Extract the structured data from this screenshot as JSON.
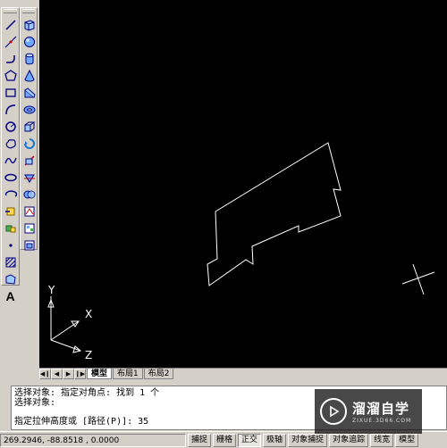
{
  "draw_toolbar": {
    "icons": [
      "line-icon",
      "construction-line-icon",
      "polyline-icon",
      "polygon-icon",
      "rectangle-icon",
      "arc-icon",
      "circle-icon",
      "revision-cloud-icon",
      "spline-icon",
      "ellipse-icon",
      "ellipse-arc-icon",
      "insert-block-icon",
      "make-block-icon",
      "point-icon",
      "hatch-icon",
      "region-icon",
      "text-icon"
    ],
    "text_tool": "A"
  },
  "modeling_toolbar": {
    "icons": [
      "box-icon",
      "sphere-icon",
      "cylinder-icon",
      "cone-icon",
      "wedge-icon",
      "torus-icon",
      "extrude-icon",
      "revolve-icon",
      "slice-icon",
      "section-icon",
      "interference-icon",
      "setup-drawing-icon",
      "setup-view-icon",
      "setup-profile-icon"
    ]
  },
  "ucs": {
    "x_label": "X",
    "y_label": "Y",
    "z_label": "Z"
  },
  "layout_tabs": [
    {
      "label": "模型",
      "active": true
    },
    {
      "label": "布局1",
      "active": false
    },
    {
      "label": "布局2",
      "active": false
    }
  ],
  "command_history": [
    "选择对象: 指定对角点: 找到 1 个",
    "选择对象:"
  ],
  "command_prompt": "指定拉伸高度或 [路径(P)]: 35",
  "status": {
    "coordinates": "269.2946, -88.8518 , 0.0000",
    "buttons": [
      {
        "label": "捕捉",
        "on": false
      },
      {
        "label": "栅格",
        "on": false
      },
      {
        "label": "正交",
        "on": true
      },
      {
        "label": "极轴",
        "on": false
      },
      {
        "label": "对象捕捉",
        "on": false
      },
      {
        "label": "对象追踪",
        "on": false
      },
      {
        "label": "线宽",
        "on": false
      },
      {
        "label": "模型",
        "on": false
      }
    ]
  },
  "watermark": {
    "title": "溜溜自学",
    "subtitle": "ZIXUE.3D66.COM"
  },
  "colors": {
    "canvas_bg": "#000000",
    "geometry": "#ffffff",
    "chrome": "#d4d0c8"
  }
}
